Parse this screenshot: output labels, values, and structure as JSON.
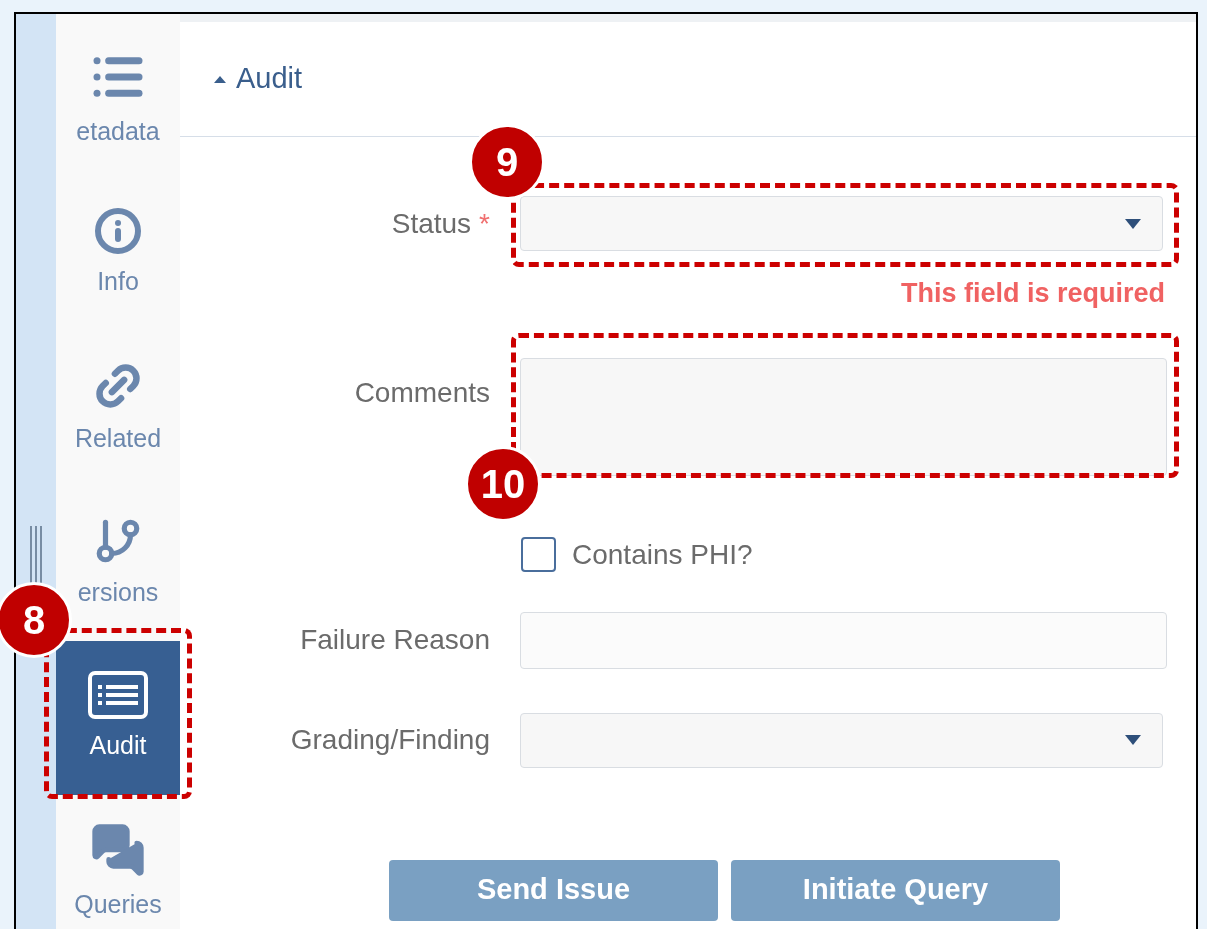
{
  "section": {
    "title": "Audit",
    "expanded": true
  },
  "sidebar": {
    "items": [
      {
        "kind": "list",
        "label": "etadata",
        "selected": false
      },
      {
        "kind": "info",
        "label": "Info",
        "selected": false
      },
      {
        "kind": "link",
        "label": "Related",
        "selected": false
      },
      {
        "kind": "branch",
        "label": "ersions",
        "selected": false
      },
      {
        "kind": "audit",
        "label": "Audit",
        "selected": true
      },
      {
        "kind": "chat",
        "label": "Queries",
        "selected": false
      }
    ]
  },
  "form": {
    "fields": [
      {
        "kind": "select",
        "label": "Status",
        "required_mark": "*",
        "error": "This field is required"
      },
      {
        "kind": "textarea",
        "label": "Comments"
      },
      {
        "kind": "checkbox",
        "label": "Contains PHI?",
        "checked": false
      },
      {
        "kind": "text",
        "label": "Failure Reason"
      },
      {
        "kind": "select",
        "label": "Grading/Finding"
      }
    ]
  },
  "buttons": [
    "Send Issue",
    "Initiate Query"
  ],
  "annotations": [
    {
      "label": "8"
    },
    {
      "label": "9"
    },
    {
      "label": "10"
    }
  ]
}
